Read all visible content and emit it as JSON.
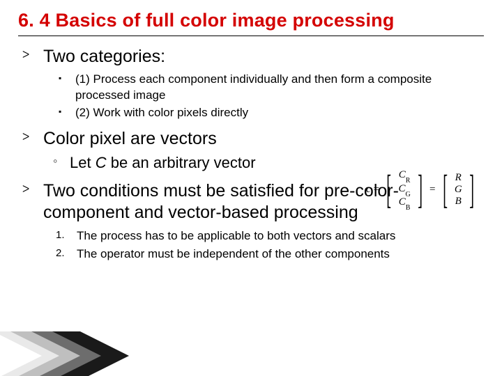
{
  "title": "6. 4 Basics of full color image processing",
  "items": [
    {
      "head": "Two categories:",
      "sublist": [
        "(1) Process each component individually and then form a composite processed image",
        "(2)  Work with color pixels directly"
      ]
    },
    {
      "head": "Color pixel are vectors",
      "circle": {
        "prefix": "Let ",
        "var": "C",
        "suffix": " be an arbitrary vector"
      }
    },
    {
      "head": "Two conditions must be satisfied  for pre-color-component and vector-based processing",
      "numbered": [
        "The process has to be applicable to both vectors and scalars",
        "The operator must be independent of the other components"
      ]
    }
  ],
  "equation": {
    "lhs": "c",
    "mid": [
      "C",
      "C",
      "C"
    ],
    "mid_sub": [
      "R",
      "G",
      "B"
    ],
    "rhs": [
      "R",
      "G",
      "B"
    ]
  }
}
